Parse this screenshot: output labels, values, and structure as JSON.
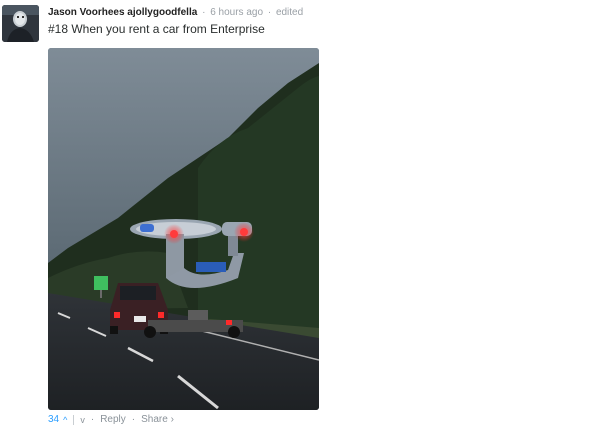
{
  "comment": {
    "author": "Jason Voorhees ajollygoodfella",
    "time": "6 hours ago",
    "edited": "edited",
    "text": "#18 When you rent a car from Enterprise"
  },
  "footer": {
    "vote_count": "34",
    "upvote_icon": "^",
    "downvote_icon": "v",
    "reply_label": "Reply",
    "share_label": "Share ›"
  },
  "image": {
    "subject": "car towing an illuminated starship-shaped float on a highway at dusk",
    "plate_text": "",
    "sign_color": "#3fbf5f"
  }
}
